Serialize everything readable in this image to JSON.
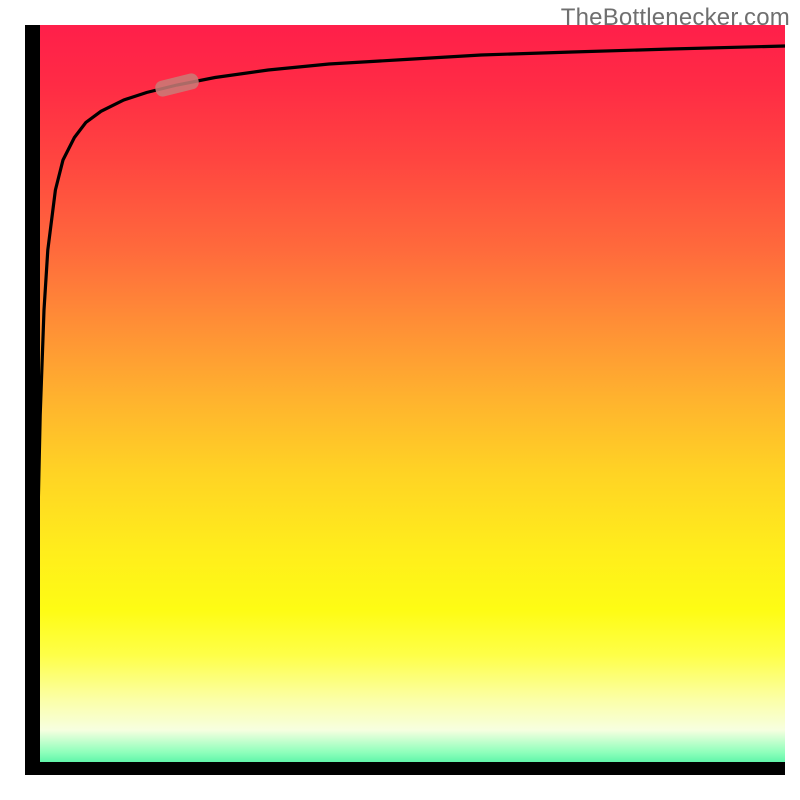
{
  "watermark": "TheBottlenecker.com",
  "colors": {
    "axis": "#000000",
    "curve": "#000000",
    "marker": "#c97d78",
    "gradient_top": "#ff1f4a",
    "gradient_bottom": "#22e994"
  },
  "chart_data": {
    "type": "line",
    "title": "",
    "xlabel": "",
    "ylabel": "",
    "xlim": [
      0,
      100
    ],
    "ylim": [
      0,
      100
    ],
    "x": [
      0.5,
      1.0,
      1.5,
      2.0,
      2.5,
      3.0,
      4.0,
      5.0,
      6.5,
      8.0,
      10,
      13,
      16,
      20,
      25,
      32,
      40,
      50,
      60,
      72,
      85,
      100
    ],
    "y": [
      2,
      8,
      25,
      48,
      62,
      70,
      78,
      82,
      85,
      87,
      88.5,
      90,
      91,
      92,
      93,
      94,
      94.8,
      95.4,
      96,
      96.4,
      96.8,
      97.2
    ],
    "marker": {
      "x": 20,
      "y": 92
    },
    "grid": false,
    "legend": false
  }
}
